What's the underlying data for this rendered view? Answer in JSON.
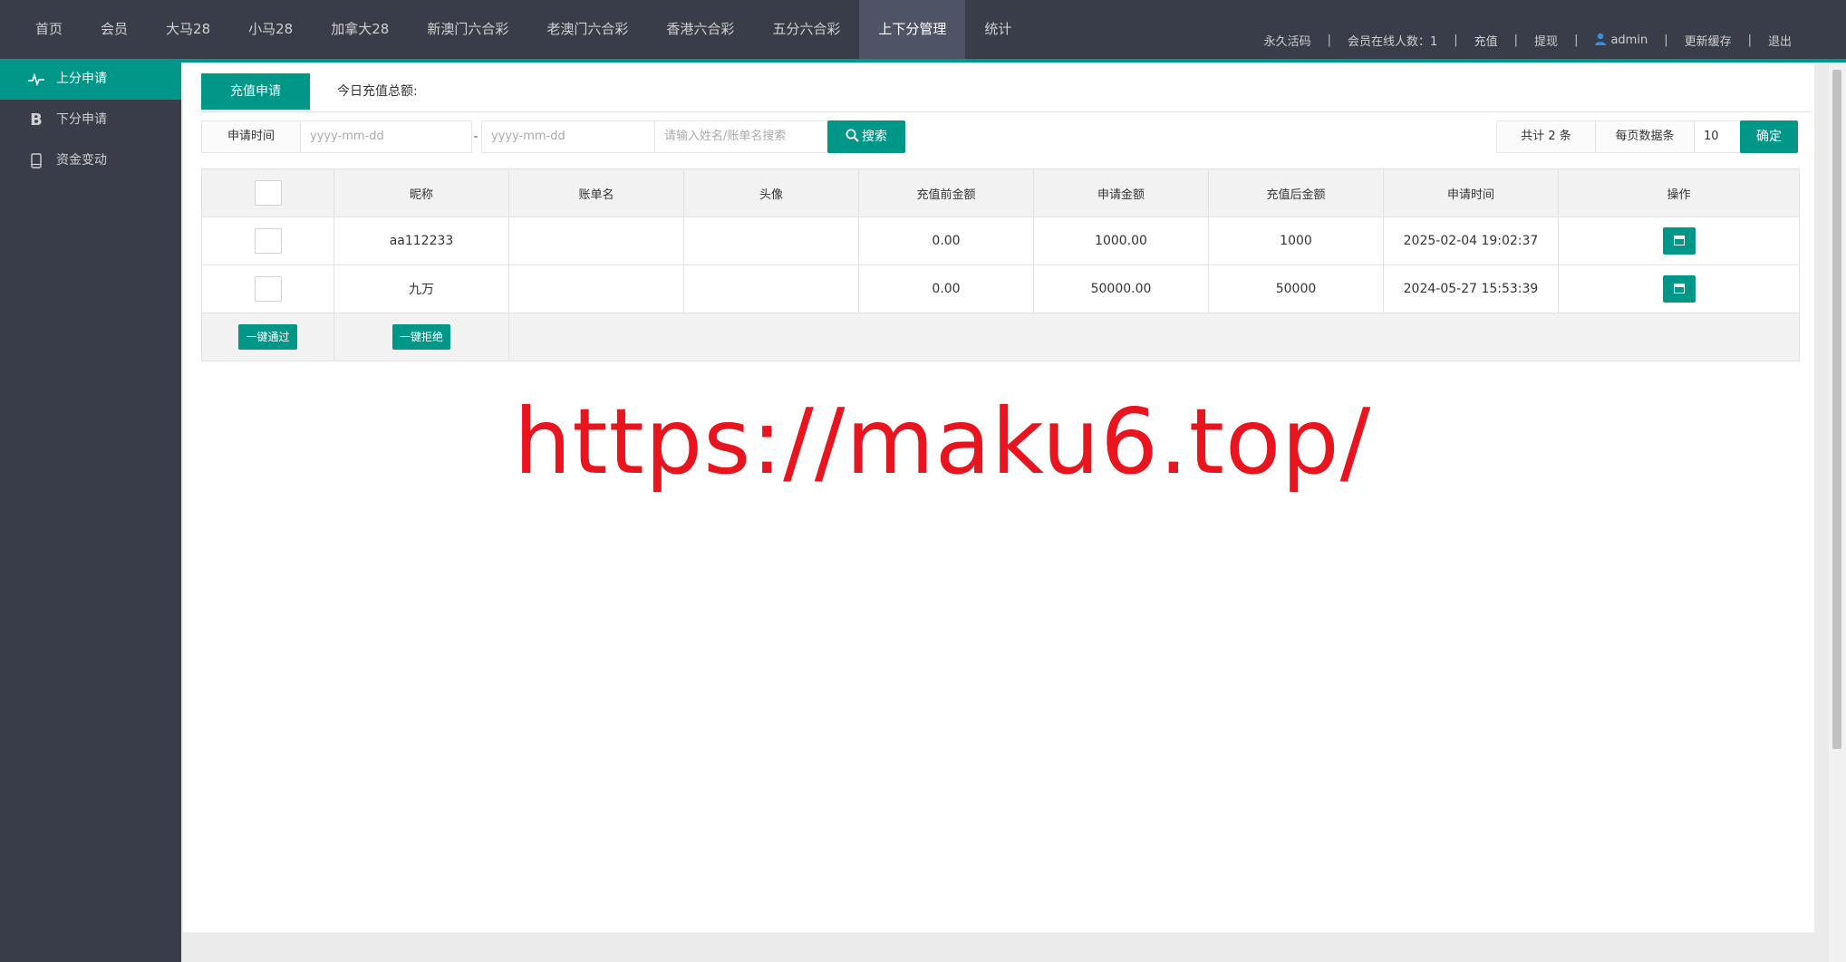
{
  "topnav": {
    "items": [
      "首页",
      "会员",
      "大马28",
      "小马28",
      "加拿大28",
      "新澳门六合彩",
      "老澳门六合彩",
      "香港六合彩",
      "五分六合彩",
      "上下分管理",
      "统计"
    ],
    "active_index": 9
  },
  "rightnav": {
    "activation": "永久活码",
    "online": "会员在线人数：1",
    "recharge": "充值",
    "withdraw": "提现",
    "user": "admin",
    "refresh_cache": "更新缓存",
    "logout": "退出"
  },
  "sidebar": {
    "items": [
      {
        "label": "上分申请",
        "icon": "pulse-icon",
        "active": true
      },
      {
        "label": "下分申请",
        "icon": "letter-b-icon",
        "active": false
      },
      {
        "label": "资金变动",
        "icon": "mobile-icon",
        "active": false
      }
    ]
  },
  "tabs": {
    "active": "充值申请",
    "today_total": "今日充值总额:"
  },
  "search": {
    "date_label": "申请时间",
    "date_from_placeholder": "yyyy-mm-dd",
    "date_to_placeholder": "yyyy-mm-dd",
    "dash": "-",
    "keyword_placeholder": "请输入姓名/账单名搜索",
    "search_button": "搜索"
  },
  "pager": {
    "total": "共计 2 条",
    "page_size_label": "每页数据条",
    "page_size": "10",
    "confirm": "确定"
  },
  "table": {
    "headers": [
      "昵称",
      "账单名",
      "头像",
      "充值前金额",
      "申请金额",
      "充值后金额",
      "申请时间",
      "操作"
    ],
    "rows": [
      {
        "nickname": "aa112233",
        "bill_name": "",
        "avatar": "",
        "before": "0.00",
        "amount": "1000.00",
        "after": "1000",
        "time": "2025-02-04 19:02:37"
      },
      {
        "nickname": "九万",
        "bill_name": "",
        "avatar": "",
        "before": "0.00",
        "amount": "50000.00",
        "after": "50000",
        "time": "2024-05-27 15:53:39"
      }
    ],
    "approve_all": "一键通过",
    "reject_all": "一键拒绝"
  },
  "watermark": "https://maku6.top/",
  "colors": {
    "accent": "#009688",
    "topbar": "#393d49",
    "watermark": "#e8141e"
  }
}
